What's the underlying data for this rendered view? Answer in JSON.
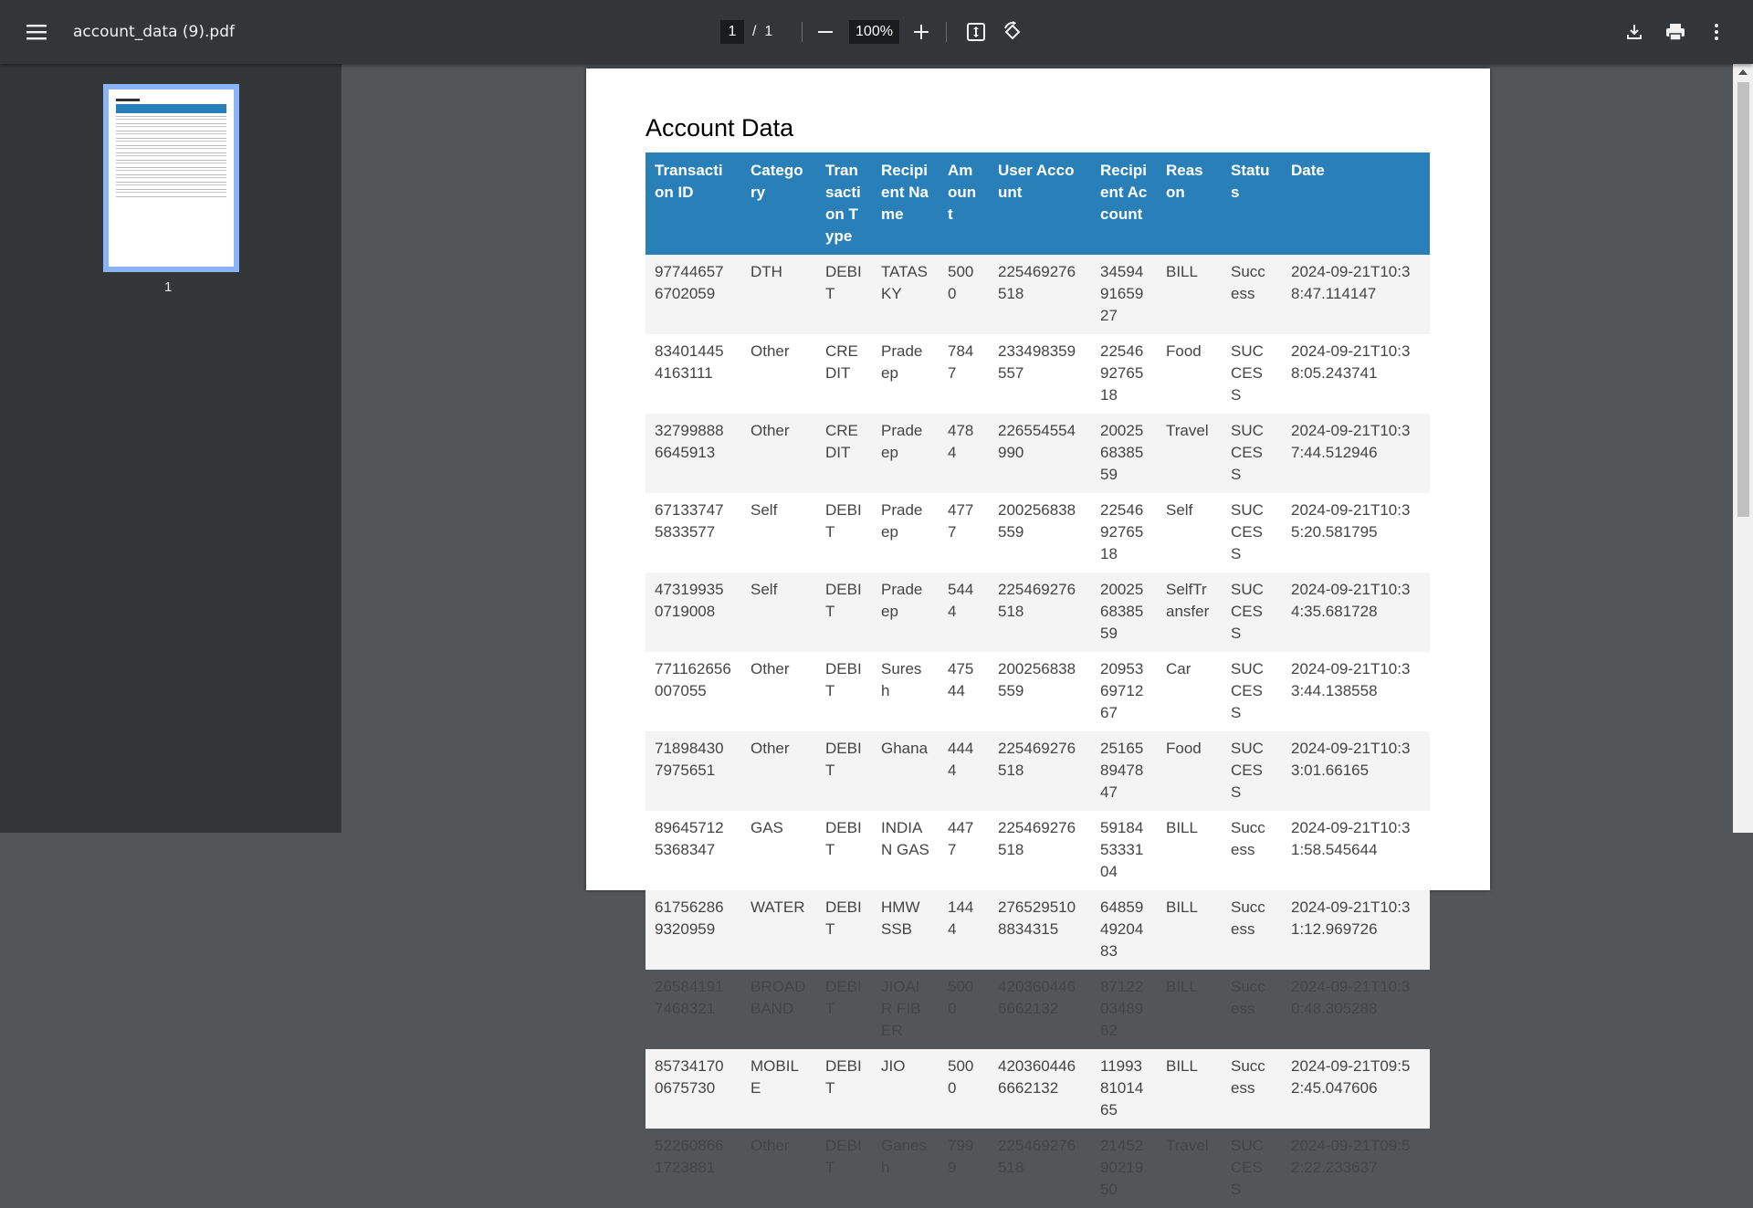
{
  "toolbar": {
    "menu_icon": "hamburger-icon",
    "file_name": "account_data (9).pdf",
    "current_page": "1",
    "page_separator": "/",
    "total_pages": "1",
    "zoom_level": "100%",
    "icons": [
      "minus-icon",
      "plus-icon",
      "fit-page-icon",
      "rotate-icon",
      "download-icon",
      "print-icon",
      "more-vert-icon"
    ]
  },
  "sidebar": {
    "thumbnail_label": "1"
  },
  "document": {
    "title": "Account Data",
    "columns": [
      "Transaction ID",
      "Category",
      "Transaction Type",
      "Recipient Name",
      "Amount",
      "User Account",
      "Recipient Account",
      "Reason",
      "Status",
      "Date"
    ],
    "rows": [
      [
        "977446576702059",
        "DTH",
        "DEBIT",
        "TATASKY",
        "5000",
        "225469276518",
        "345949165927",
        "BILL",
        "Success",
        "2024-09-21T10:38:47.114147"
      ],
      [
        "834014454163111",
        "Other",
        "CREDIT",
        "Pradeep",
        "7847",
        "233498359557",
        "225469276518",
        "Food",
        "SUCCESS",
        "2024-09-21T10:38:05.243741"
      ],
      [
        "327998886645913",
        "Other",
        "CREDIT",
        "Pradeep",
        "4784",
        "226554554990",
        "200256838559",
        "Travel",
        "SUCCESS",
        "2024-09-21T10:37:44.512946"
      ],
      [
        "671337475833577",
        "Self",
        "DEBIT",
        "Pradeep",
        "4777",
        "200256838559",
        "225469276518",
        "Self",
        "SUCCESS",
        "2024-09-21T10:35:20.581795"
      ],
      [
        "473199350719008",
        "Self",
        "DEBIT",
        "Pradeep",
        "5444",
        "225469276518",
        "200256838559",
        "SelfTransfer",
        "SUCCESS",
        "2024-09-21T10:34:35.681728"
      ],
      [
        "771162656007055",
        "Other",
        "DEBIT",
        "Suresh",
        "47544",
        "200256838559",
        "209536971267",
        "Car",
        "SUCCESS",
        "2024-09-21T10:33:44.138558"
      ],
      [
        "718984307975651",
        "Other",
        "DEBIT",
        "Ghana",
        "4444",
        "225469276518",
        "251658947847",
        "Food",
        "SUCCESS",
        "2024-09-21T10:33:01.66165"
      ],
      [
        "896457125368347",
        "GAS",
        "DEBIT",
        "INDIAN GAS",
        "4477",
        "225469276518",
        "591845333104",
        "BILL",
        "Success",
        "2024-09-21T10:31:58.545644"
      ],
      [
        "617562869320959",
        "WATER",
        "DEBIT",
        "HMWSSB",
        "1444",
        "2765295108834315",
        "648594920483",
        "BILL",
        "Success",
        "2024-09-21T10:31:12.969726"
      ],
      [
        "265841917468321",
        "BROADBAND",
        "DEBIT",
        "JIOAIR FIBER",
        "5000",
        "4203604466662132",
        "871220348962",
        "BILL",
        "Success",
        "2024-09-21T10:30:48.305288"
      ],
      [
        "857341700675730",
        "MOBILE",
        "DEBIT",
        "JIO",
        "5000",
        "4203604466662132",
        "119938101465",
        "BILL",
        "Success",
        "2024-09-21T09:52:45.047606"
      ],
      [
        "522608661723881",
        "Other",
        "DEBIT",
        "Ganesh",
        "7999",
        "225469276518",
        "214529021950",
        "Travel",
        "SUCCESS",
        "2024-09-21T09:52:22.233637"
      ]
    ]
  },
  "colors": {
    "header_bg": "#2980b9",
    "toolbar_bg": "#323639",
    "viewer_bg": "#525659",
    "thumb_border": "#8ab4f8"
  }
}
